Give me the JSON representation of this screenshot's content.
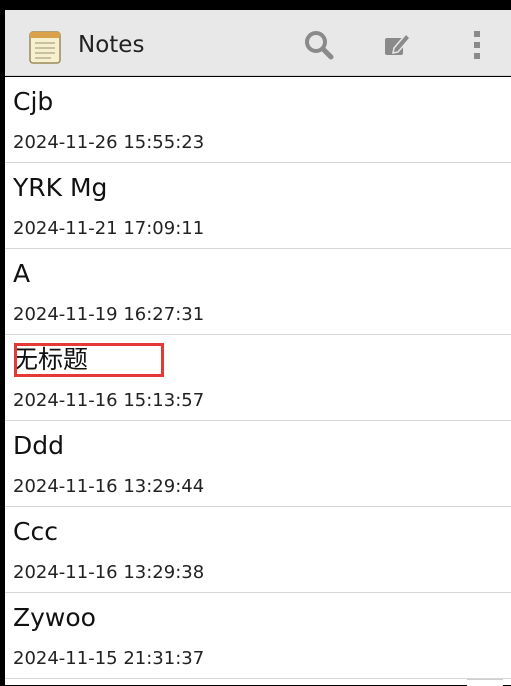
{
  "app_bar": {
    "title": "Notes",
    "icons": {
      "app": "notepad-icon",
      "search": "search-icon",
      "compose": "compose-icon",
      "overflow": "more-vert-icon"
    }
  },
  "notes": [
    {
      "title": "Cjb",
      "date": "2024-11-26 15:55:23",
      "highlighted": false
    },
    {
      "title": "YRK Mg",
      "date": "2024-11-21 17:09:11",
      "highlighted": false
    },
    {
      "title": "A",
      "date": "2024-11-19 16:27:31",
      "highlighted": false
    },
    {
      "title": "无标题",
      "date": "2024-11-16 15:13:57",
      "highlighted": true
    },
    {
      "title": "Ddd",
      "date": "2024-11-16 13:29:44",
      "highlighted": false
    },
    {
      "title": "Ccc",
      "date": "2024-11-16 13:29:38",
      "highlighted": false
    },
    {
      "title": "Zywoo",
      "date": "2024-11-15 21:31:37",
      "highlighted": false
    }
  ],
  "colors": {
    "app_bar_bg": "#e8e8e8",
    "highlight": "#e53935",
    "icon_gray": "#8a8a8a"
  }
}
